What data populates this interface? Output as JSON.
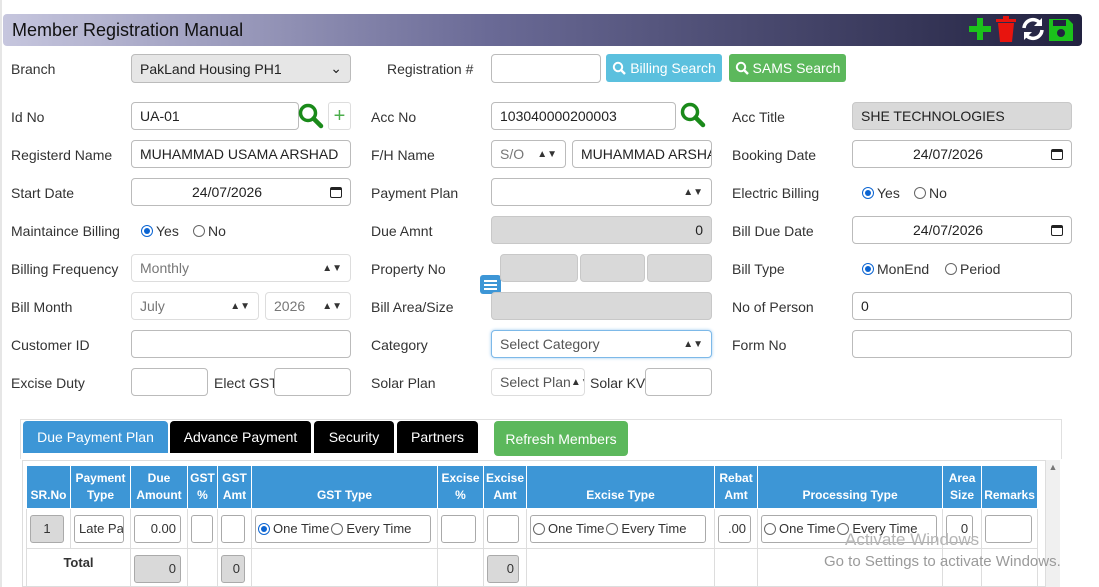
{
  "title": "Member Registration Manual",
  "toolbar": {
    "add_icon": "plus-icon",
    "delete_icon": "trash-icon",
    "refresh_icon": "refresh-icon",
    "save_icon": "save-icon",
    "add_color": "#1bc21b",
    "delete_color": "#e8140e"
  },
  "form": {
    "branch": {
      "label": "Branch",
      "value": "PakLand Housing PH1"
    },
    "registration": {
      "label": "Registration #",
      "value": ""
    },
    "billing_search": "Billing Search",
    "sams_search": "SAMS Search",
    "id_no": {
      "label": "Id No",
      "value": "UA-01"
    },
    "acc_no": {
      "label": "Acc No",
      "value": "103040000200003"
    },
    "acc_title": {
      "label": "Acc Title",
      "value": "SHE TECHNOLOGIES"
    },
    "registered_name": {
      "label": "Registerd Name",
      "value": "MUHAMMAD USAMA ARSHAD"
    },
    "fh_name": {
      "label": "F/H Name",
      "relation": "S/O",
      "value": "MUHAMMAD ARSHAD"
    },
    "booking_date": {
      "label": "Booking Date",
      "value": "24/07/2026"
    },
    "start_date": {
      "label": "Start Date",
      "value": "24/07/2026"
    },
    "payment_plan": {
      "label": "Payment Plan",
      "value": ""
    },
    "electric_billing": {
      "label": "Electric Billing",
      "yes": "Yes",
      "no": "No",
      "selected": "Yes"
    },
    "maintenance_billing": {
      "label": "Maintaince Billing",
      "yes": "Yes",
      "no": "No",
      "selected": "Yes"
    },
    "due_amnt": {
      "label": "Due Amnt",
      "value": "0"
    },
    "bill_due_date": {
      "label": "Bill Due Date",
      "value": "24/07/2026"
    },
    "billing_frequency": {
      "label": "Billing Frequency",
      "value": "Monthly"
    },
    "property_no": {
      "label": "Property No"
    },
    "bill_type": {
      "label": "Bill Type",
      "opt1": "MonEnd",
      "opt2": "Period",
      "selected": "MonEnd"
    },
    "bill_month": {
      "label": "Bill Month",
      "month": "July",
      "year": "2026"
    },
    "bill_area": {
      "label": "Bill Area/Size",
      "value": ""
    },
    "no_of_person": {
      "label": "No of Person",
      "value": "0"
    },
    "customer_id": {
      "label": "Customer ID",
      "value": ""
    },
    "category": {
      "label": "Category",
      "value": "Select Category"
    },
    "form_no": {
      "label": "Form No",
      "value": ""
    },
    "excise_duty": {
      "label": "Excise Duty",
      "value": ""
    },
    "elect_gst": {
      "label": "Elect GST",
      "value": ""
    },
    "solar_plan": {
      "label": "Solar Plan",
      "value": "Select Plan"
    },
    "solar_kv": {
      "label": "Solar KV",
      "value": ""
    }
  },
  "tabs": [
    {
      "label": "Due Payment Plan",
      "color": "#3d96d6"
    },
    {
      "label": "Advance Payment",
      "color": "#000000"
    },
    {
      "label": "Security",
      "color": "#000000"
    },
    {
      "label": "Partners",
      "color": "#000000"
    }
  ],
  "refresh_members": "Refresh Members",
  "grid": {
    "headers": {
      "srno": "SR.No",
      "payment_type_1": "Payment",
      "payment_type_2": "Type",
      "due_1": "Due",
      "due_2": "Amount",
      "gst_1": "GST",
      "gst_2": "%",
      "gstamt_1": "GST",
      "gstamt_2": "Amt",
      "gst_type": "GST Type",
      "excise_1": "Excise",
      "excise_2": "%",
      "exciseamt_1": "Excise",
      "exciseamt_2": "Amt",
      "excise_type": "Excise Type",
      "rebat_1": "Rebat",
      "rebat_2": "Amt",
      "processing_type": "Processing Type",
      "area_1": "Area",
      "area_2": "Size",
      "remarks": "Remarks"
    },
    "row": {
      "srno": "1",
      "payment_type": "Late Pa",
      "due_amount": "0.00",
      "rebat": ".00",
      "area": "0",
      "one_time": "One Time",
      "every_time": "Every Time"
    },
    "total": {
      "label": "Total",
      "due": "0",
      "gst_amt": "0",
      "excise_amt": "0"
    }
  },
  "watermark": {
    "line1": "Activate Windows",
    "line2": "Go to Settings to activate Windows."
  }
}
